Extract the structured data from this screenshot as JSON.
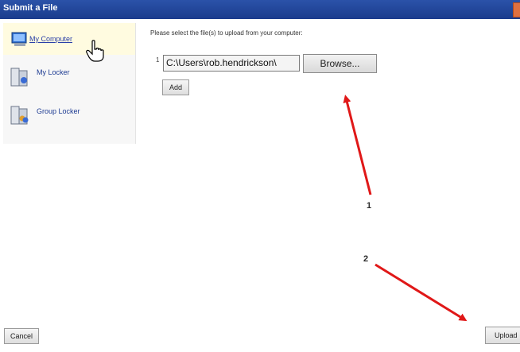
{
  "window": {
    "title": "Submit a File"
  },
  "sidebar": {
    "items": [
      {
        "label": "My Computer",
        "icon": "computer-icon"
      },
      {
        "label": "My Locker",
        "icon": "locker-icon"
      },
      {
        "label": "Group Locker",
        "icon": "group-locker-icon"
      }
    ]
  },
  "main": {
    "instruction": "Please select the file(s) to upload from your computer:",
    "rows": [
      {
        "number": "1",
        "file_value": "C:\\Users\\rob.hendrickson\\"
      }
    ],
    "browse_label": "Browse...",
    "add_label": "Add"
  },
  "footer": {
    "cancel_label": "Cancel",
    "upload_label": "Upload"
  },
  "annotations": {
    "callout_1": "1",
    "callout_2": "2",
    "arrow_color": "#e01818"
  }
}
